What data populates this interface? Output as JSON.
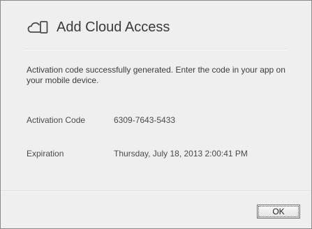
{
  "dialog": {
    "title": "Add Cloud Access",
    "icon": "cloud-device-icon",
    "message": "Activation code successfully generated. Enter the code in your app on your mobile device.",
    "activation_code_label": "Activation Code",
    "activation_code_value": "6309-7643-5433",
    "expiration_label": "Expiration",
    "expiration_value": "Thursday, July 18, 2013 2:00:41 PM",
    "ok_label": "OK"
  }
}
